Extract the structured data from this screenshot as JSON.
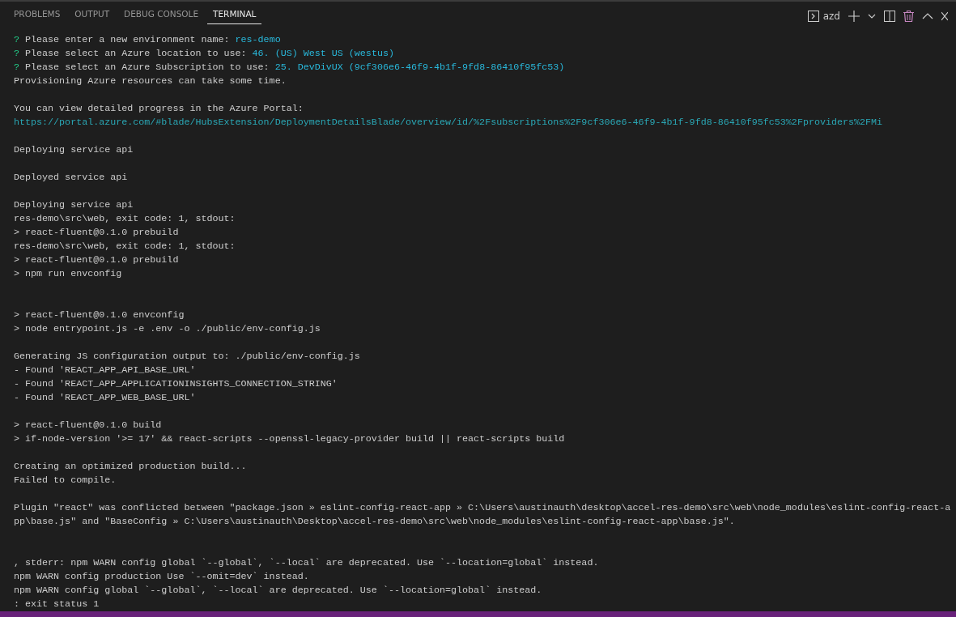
{
  "tabs": [
    {
      "label": "PROBLEMS",
      "selected": false
    },
    {
      "label": "OUTPUT",
      "selected": false
    },
    {
      "label": "DEBUG CONSOLE",
      "selected": false
    },
    {
      "label": "TERMINAL",
      "selected": true
    }
  ],
  "terminal_selector": {
    "label": "azd"
  },
  "lines": [
    {
      "kind": "prompt",
      "mark": "?",
      "text": "Please enter a new environment name:",
      "answer": "res-demo"
    },
    {
      "kind": "prompt",
      "mark": "?",
      "text": "Please select an Azure location to use:",
      "answer": "46. (US) West US (westus)"
    },
    {
      "kind": "prompt",
      "mark": "?",
      "text": "Please select an Azure Subscription to use:",
      "answer": "25. DevDivUX (9cf306e6-46f9-4b1f-9fd8-86410f95fc53)"
    },
    {
      "kind": "plain",
      "text": "Provisioning Azure resources can take some time."
    },
    {
      "kind": "blank"
    },
    {
      "kind": "plain",
      "text": "You can view detailed progress in the Azure Portal:"
    },
    {
      "kind": "link",
      "text": "https://portal.azure.com/#blade/HubsExtension/DeploymentDetailsBlade/overview/id/%2Fsubscriptions%2F9cf306e6-46f9-4b1f-9fd8-86410f95fc53%2Fproviders%2FMi"
    },
    {
      "kind": "blank"
    },
    {
      "kind": "plain",
      "text": "Deploying service api"
    },
    {
      "kind": "blank"
    },
    {
      "kind": "plain",
      "text": "Deployed service api"
    },
    {
      "kind": "blank"
    },
    {
      "kind": "plain",
      "text": "Deploying service api"
    },
    {
      "kind": "plain",
      "text": "res-demo\\src\\web, exit code: 1, stdout:"
    },
    {
      "kind": "plain",
      "text": "> react-fluent@0.1.0 prebuild"
    },
    {
      "kind": "plain",
      "text": "res-demo\\src\\web, exit code: 1, stdout:"
    },
    {
      "kind": "plain",
      "text": "> react-fluent@0.1.0 prebuild"
    },
    {
      "kind": "plain",
      "text": "> npm run envconfig"
    },
    {
      "kind": "blank"
    },
    {
      "kind": "blank"
    },
    {
      "kind": "plain",
      "text": "> react-fluent@0.1.0 envconfig"
    },
    {
      "kind": "plain",
      "text": "> node entrypoint.js -e .env -o ./public/env-config.js"
    },
    {
      "kind": "blank"
    },
    {
      "kind": "plain",
      "text": "Generating JS configuration output to: ./public/env-config.js"
    },
    {
      "kind": "plain",
      "text": "- Found 'REACT_APP_API_BASE_URL'"
    },
    {
      "kind": "plain",
      "text": "- Found 'REACT_APP_APPLICATIONINSIGHTS_CONNECTION_STRING'"
    },
    {
      "kind": "plain",
      "text": "- Found 'REACT_APP_WEB_BASE_URL'"
    },
    {
      "kind": "blank"
    },
    {
      "kind": "plain",
      "text": "> react-fluent@0.1.0 build"
    },
    {
      "kind": "plain",
      "text": "> if-node-version '>= 17' && react-scripts --openssl-legacy-provider build || react-scripts build"
    },
    {
      "kind": "blank"
    },
    {
      "kind": "plain",
      "text": "Creating an optimized production build..."
    },
    {
      "kind": "plain",
      "text": "Failed to compile."
    },
    {
      "kind": "blank"
    },
    {
      "kind": "plain",
      "text": "Plugin \"react\" was conflicted between \"package.json » eslint-config-react-app » C:\\Users\\austinauth\\desktop\\accel-res-demo\\src\\web\\node_modules\\eslint-config-react-a"
    },
    {
      "kind": "plain",
      "text": "pp\\base.js\" and \"BaseConfig » C:\\Users\\austinauth\\Desktop\\accel-res-demo\\src\\web\\node_modules\\eslint-config-react-app\\base.js\"."
    },
    {
      "kind": "blank"
    },
    {
      "kind": "blank"
    },
    {
      "kind": "plain",
      "text": ", stderr: npm WARN config global `--global`, `--local` are deprecated. Use `--location=global` instead."
    },
    {
      "kind": "plain",
      "text": "npm WARN config production Use `--omit=dev` instead."
    },
    {
      "kind": "plain",
      "text": "npm WARN config global `--global`, `--local` are deprecated. Use `--location=global` instead."
    },
    {
      "kind": "plain",
      "text": ": exit status 1"
    }
  ]
}
